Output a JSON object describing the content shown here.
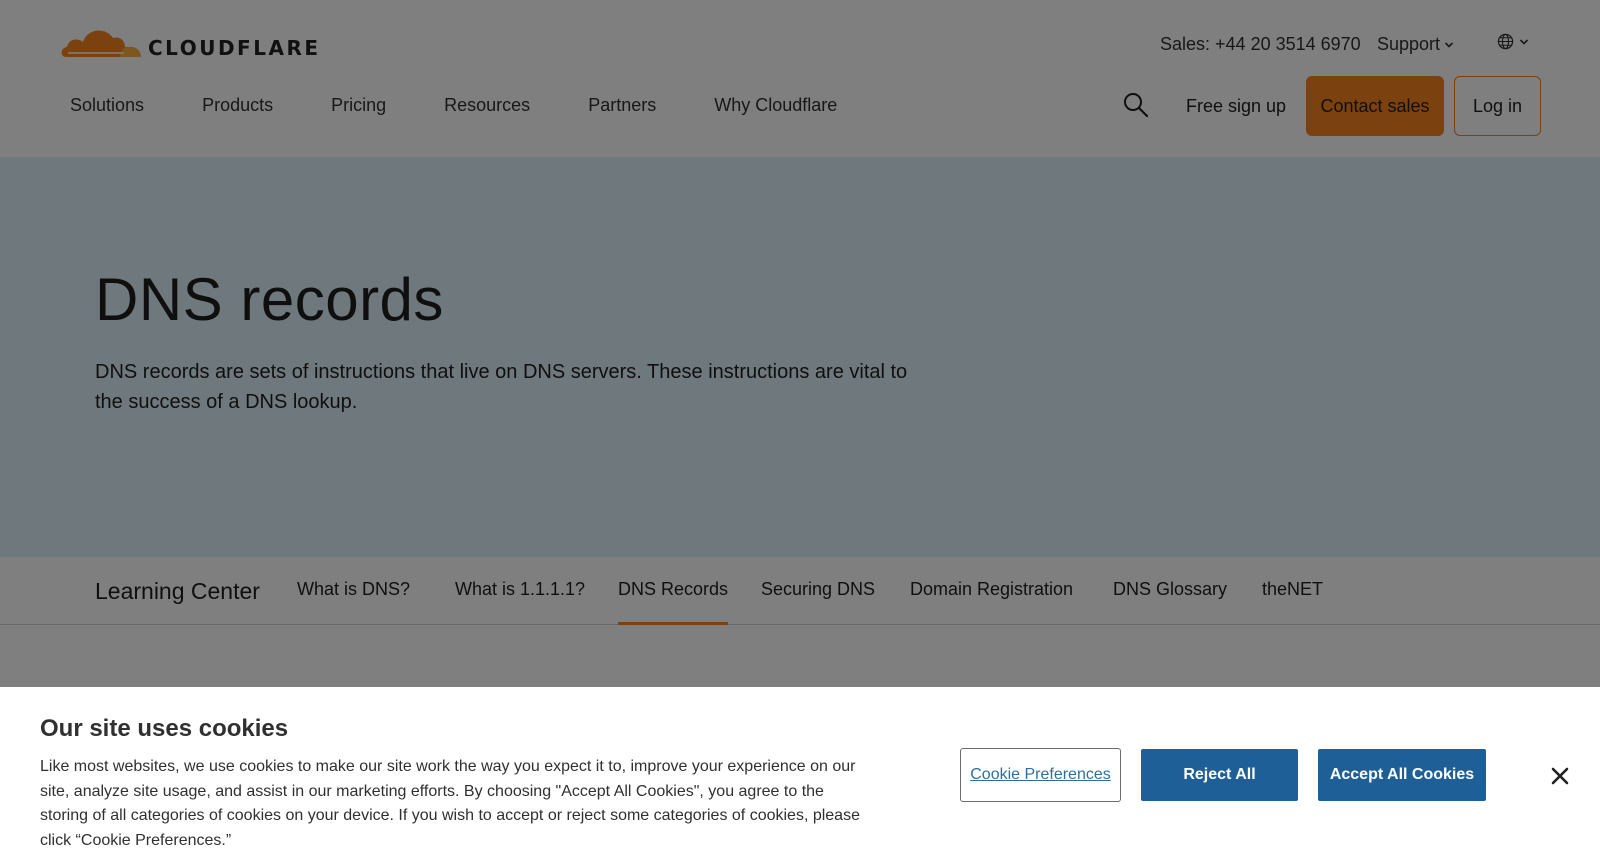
{
  "brand": {
    "name": "CLOUDFLARE"
  },
  "header": {
    "sales": "Sales: +44 20 3514 6970",
    "support": "Support",
    "nav": [
      "Solutions",
      "Products",
      "Pricing",
      "Resources",
      "Partners",
      "Why Cloudflare"
    ],
    "free_signup": "Free sign up",
    "contact_sales": "Contact sales",
    "login": "Log in"
  },
  "hero": {
    "title": "DNS records",
    "description": "DNS records are sets of instructions that live on DNS servers. These instructions are vital to the success of a DNS lookup."
  },
  "learning_center": {
    "title": "Learning Center",
    "tabs": [
      {
        "label": "What is DNS?"
      },
      {
        "label": "What is 1.1.1.1?"
      },
      {
        "label": "DNS Records",
        "active": true
      },
      {
        "label": "Securing DNS"
      },
      {
        "label": "Domain Registration"
      },
      {
        "label": "DNS Glossary"
      },
      {
        "label": "theNET"
      }
    ]
  },
  "cookie_banner": {
    "title": "Our site uses cookies",
    "text": "Like most websites, we use cookies to make our site work the way you expect it to, improve your experience on our site, analyze site usage, and assist in our marketing efforts. By choosing \"Accept All Cookies\", you agree to the storing of all categories of cookies on your device. If you wish to accept or reject some categories of cookies, please click “Cookie Preferences.”",
    "preferences": "Cookie Preferences",
    "reject": "Reject All",
    "accept": "Accept All Cookies"
  },
  "colors": {
    "brand_orange": "#f6821f",
    "hero_bg": "#dff0fa",
    "cookie_button": "#1f5f97",
    "overlay": "rgba(0,0,0,0.5)"
  },
  "icons": [
    "cloudflare-logo-icon",
    "chevron-down-icon",
    "globe-icon",
    "search-icon",
    "close-icon"
  ]
}
